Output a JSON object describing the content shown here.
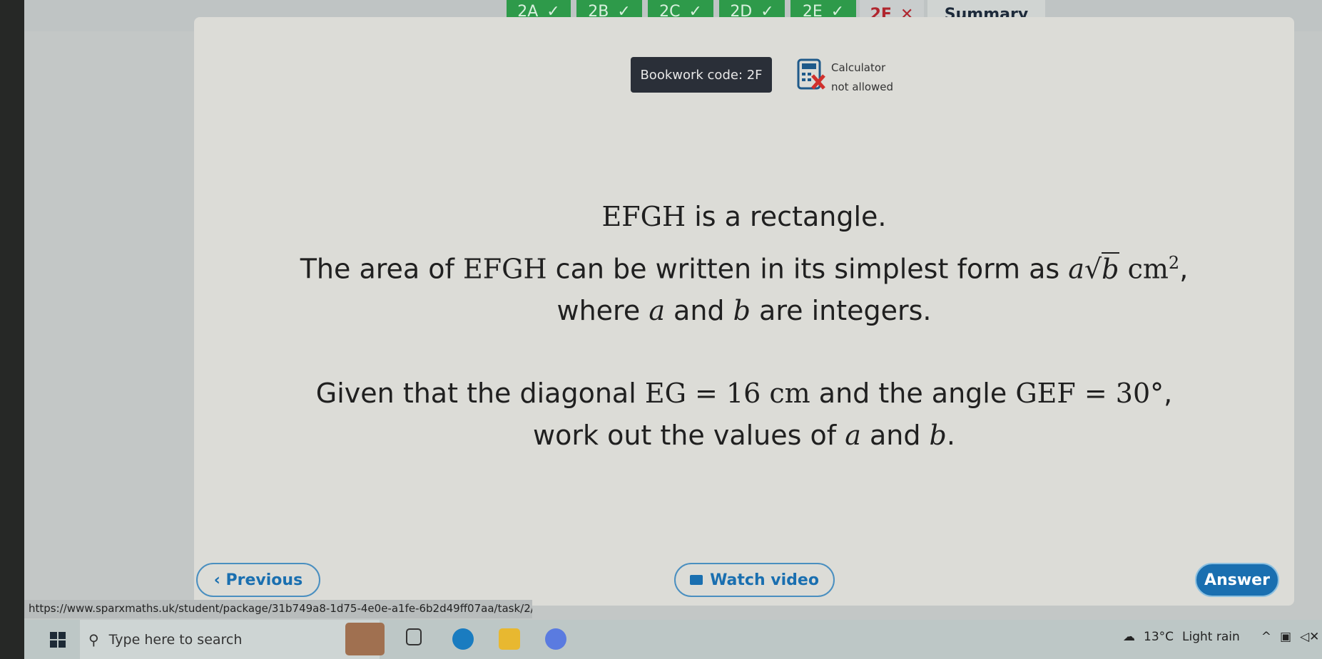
{
  "tabs": [
    {
      "label": "2A",
      "status": "correct"
    },
    {
      "label": "2B",
      "status": "correct"
    },
    {
      "label": "2C",
      "status": "correct"
    },
    {
      "label": "2D",
      "status": "correct"
    },
    {
      "label": "2E",
      "status": "correct"
    },
    {
      "label": "2F",
      "status": "incorrect"
    },
    {
      "label": "Summary"
    }
  ],
  "check": "✓",
  "cross": "✕",
  "bookwork": "Bookwork code: 2F",
  "calculator": {
    "line1": "Calculator",
    "line2": "not allowed"
  },
  "question": {
    "l1_math": "EFGH",
    "l1_text": " is a rectangle.",
    "l2_a": "The area of ",
    "l2_math": "EFGH",
    "l2_b": " can be written in its simplest form as ",
    "l2_expr_a": "a",
    "l2_expr_b": "b",
    "l2_unit": "cm",
    "l2_exp": "2",
    "l2_end": ",",
    "l3_a": "where ",
    "l3_v1": "a",
    "l3_b": " and ",
    "l3_v2": "b",
    "l3_c": " are integers.",
    "l4_a": "Given that the diagonal ",
    "l4_m1": "EG = 16 cm",
    "l4_b": " and the angle ",
    "l4_m2": "GEF = 30°",
    "l4_c": ",",
    "l5_a": "work out the values of ",
    "l5_v1": "a",
    "l5_b": " and ",
    "l5_v2": "b",
    "l5_c": "."
  },
  "buttons": {
    "previous": "Previous",
    "watch": "Watch video",
    "answer": "Answer"
  },
  "url": "https://www.sparxmaths.uk/student/package/31b749a8-1d75-4e0e-a1fe-6b2d49ff07aa/task/2/item/5",
  "taskbar": {
    "search_placeholder": "Type here to search",
    "weather": "13°C",
    "weather_desc": "Light rain"
  },
  "colors": {
    "correct": "#2e9a4a",
    "incorrect": "#b0262e",
    "accent": "#1a6fb0"
  }
}
